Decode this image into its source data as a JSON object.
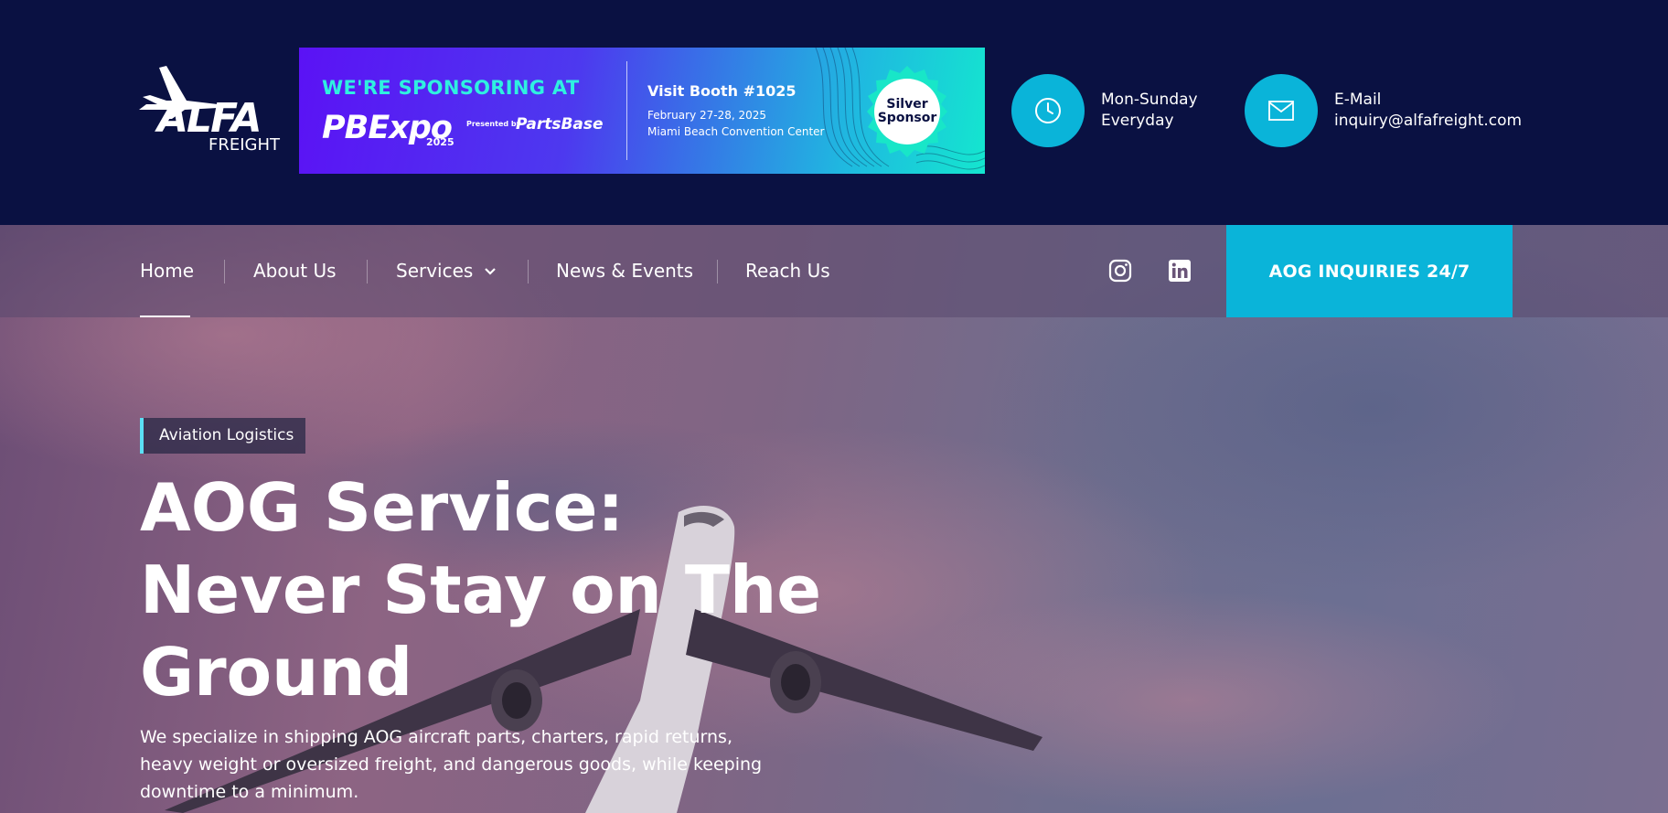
{
  "brand": {
    "logo_text": "ALFA",
    "logo_subtext": "FREIGHT"
  },
  "banner": {
    "headline": "WE'RE SPONSORING AT",
    "event_name": "PBExpo",
    "event_year": "2025",
    "presented_by": "Presented by",
    "presenter": "PartsBase",
    "booth": "Visit Booth #1025",
    "dates": "February 27-28, 2025",
    "venue": "Miami Beach Convention Center",
    "badge_line1": "Silver",
    "badge_line2": "Sponsor"
  },
  "contacts": [
    {
      "icon": "clock-icon",
      "line1": "Mon-Sunday",
      "line2": "Everyday"
    },
    {
      "icon": "mail-icon",
      "line1": "E-Mail",
      "line2": "inquiry@alfafreight.com"
    }
  ],
  "nav": {
    "items": [
      "Home",
      "About Us",
      "Services",
      "News & Events",
      "Reach Us"
    ],
    "active": "Home",
    "social": [
      "instagram-icon",
      "linkedin-icon"
    ],
    "cta": "AOG INQUIRIES 24/7"
  },
  "hero": {
    "tag": "Aviation Logistics",
    "headline_lines": [
      "AOG Service:",
      "Never Stay on The",
      "Ground"
    ],
    "lead": "We specialize in shipping AOG aircraft parts, charters, rapid returns, heavy weight or oversized freight, and dangerous goods, while keeping downtime to a minimum."
  },
  "colors": {
    "header_bg": "#0a1142",
    "accent": "#0ab4d9",
    "tag_border": "#5be0f5"
  }
}
